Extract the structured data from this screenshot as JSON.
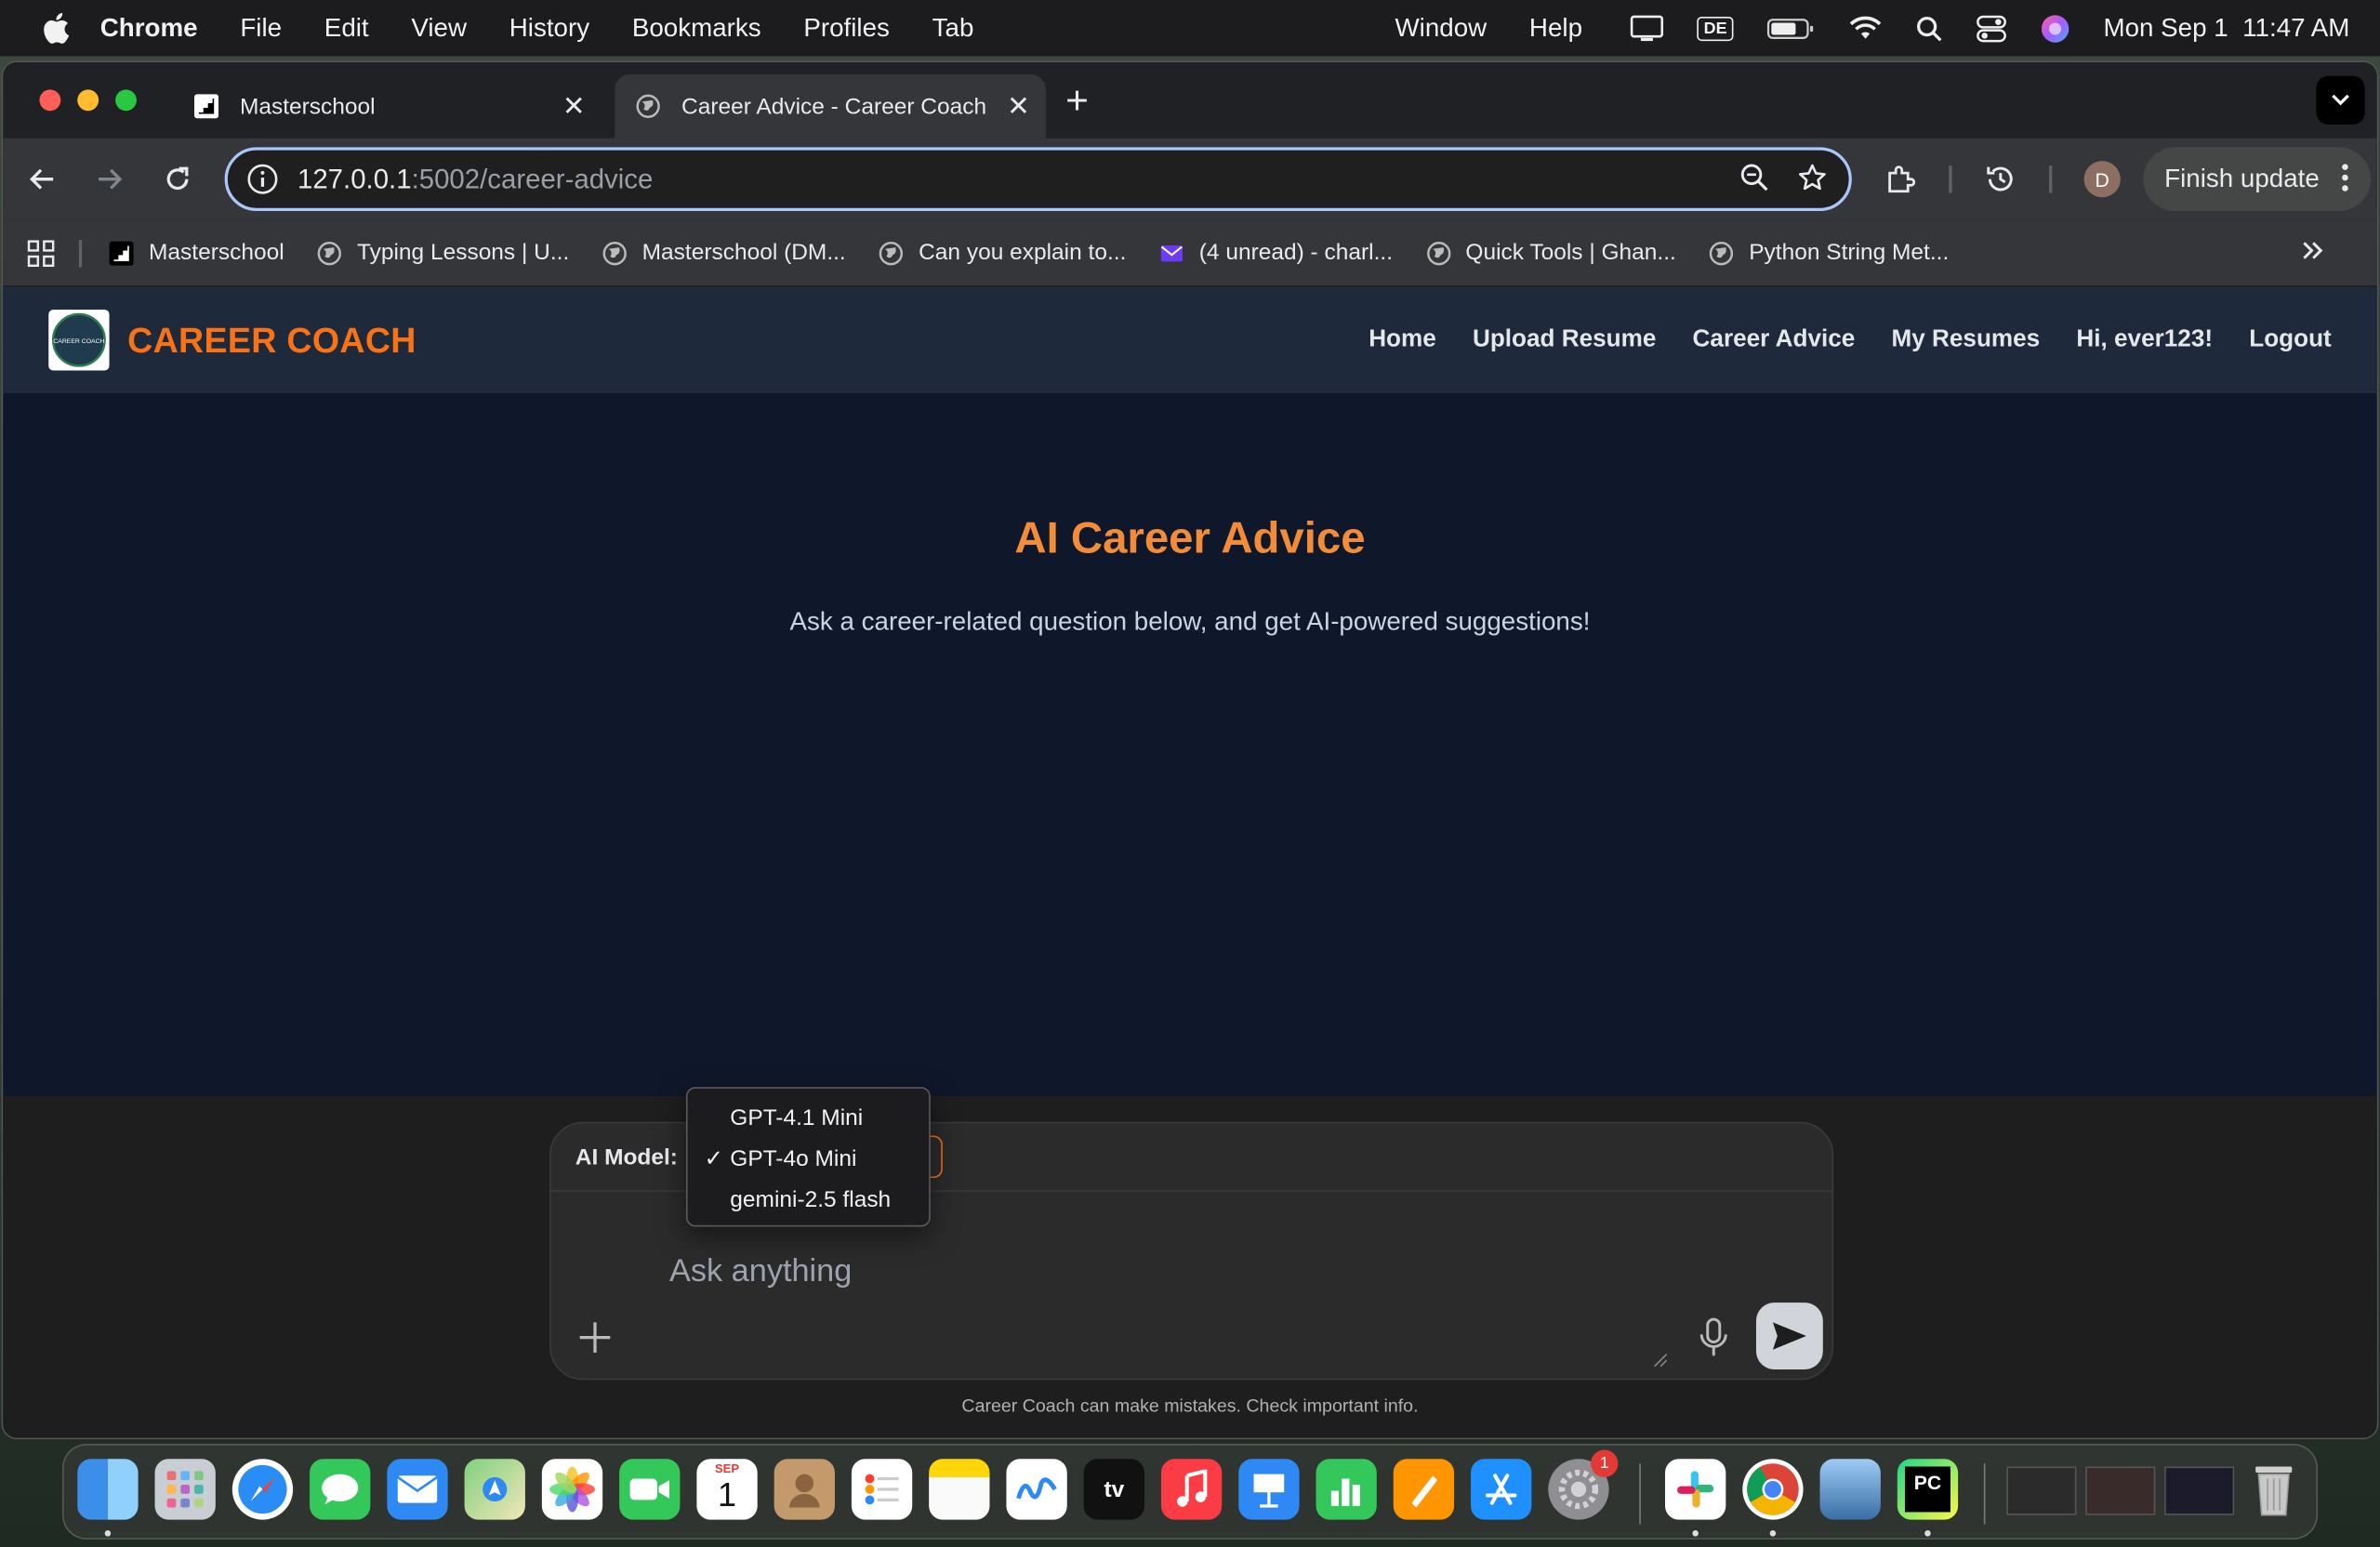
{
  "menubar": {
    "app": "Chrome",
    "items": [
      "File",
      "Edit",
      "View",
      "History",
      "Bookmarks",
      "Profiles",
      "Tab"
    ],
    "right_items": [
      "Window",
      "Help"
    ],
    "keyboard_layout": "DE",
    "datetime": "Mon Sep 1  11:47 AM"
  },
  "tabs": [
    {
      "title": "Masterschool",
      "active": false
    },
    {
      "title": "Career Advice - Career Coach",
      "active": true
    }
  ],
  "toolbar": {
    "url_host": "127.0.0.1",
    "url_path": ":5002/career-advice",
    "profile_initial": "D",
    "finish_update": "Finish update"
  },
  "bookmarks": [
    {
      "label": "Masterschool",
      "icon": "masterschool-icon"
    },
    {
      "label": "Typing Lessons | U...",
      "icon": "globe-icon"
    },
    {
      "label": "Masterschool (DM...",
      "icon": "globe-icon"
    },
    {
      "label": "Can you explain to...",
      "icon": "globe-icon"
    },
    {
      "label": "(4 unread) - charl...",
      "icon": "mail-icon"
    },
    {
      "label": "Quick Tools | Ghan...",
      "icon": "globe-icon"
    },
    {
      "label": "Python String Met...",
      "icon": "globe-icon"
    }
  ],
  "site": {
    "logo_text": "CAREER COACH",
    "brand": "CAREER COACH",
    "nav": [
      "Home",
      "Upload Resume",
      "Career Advice",
      "My Resumes",
      "Hi, ever123!",
      "Logout"
    ],
    "title": "AI Career Advice",
    "subtitle": "Ask a career-related question below, and get AI-powered suggestions!",
    "model_label": "AI Model:",
    "model_options": [
      "GPT-4.1 Mini",
      "GPT-4o Mini",
      "gemini-2.5 flash"
    ],
    "selected_model": "GPT-4o Mini",
    "prompt_placeholder": "Ask anything",
    "disclaimer": "Career Coach can make mistakes. Check important info.",
    "accent_color": "#f97316"
  },
  "dock": {
    "apps": [
      "Finder",
      "Launchpad",
      "Safari",
      "Messages",
      "Mail",
      "Maps",
      "Photos",
      "FaceTime",
      "Calendar",
      "Contacts",
      "Reminders",
      "Notes",
      "Freeform",
      "TV",
      "Music",
      "Keynote",
      "Numbers",
      "Pages",
      "App Store",
      "System Settings",
      "Slack",
      "Chrome",
      "Preview",
      "PyCharm"
    ],
    "calendar_month": "SEP",
    "calendar_day": "1",
    "settings_badge": "1",
    "tv_label": "tv",
    "pycharm_label": "PC"
  }
}
